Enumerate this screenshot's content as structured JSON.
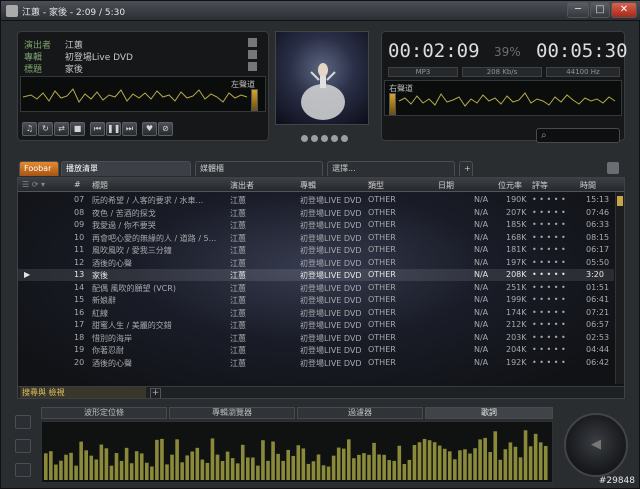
{
  "window": {
    "title": "江蕙 - 家後 - 2:09 / 5:30",
    "buttons": {
      "minimize": "─",
      "maximize": "□",
      "close": "✕"
    }
  },
  "nowplaying": {
    "artist_label": "演出者",
    "artist": "江蕙",
    "album_label": "專輯",
    "album": "初登場Live DVD",
    "title_label": "標題",
    "title": "家後",
    "left_channel": "左聲道",
    "right_channel": "右聲道"
  },
  "timer": {
    "elapsed": "00:02:09",
    "percent": "39%",
    "total": "00:05:30",
    "format": "MP3",
    "bitrate": "208 Kb/s",
    "samplerate": "44100 Hz"
  },
  "controls": [
    "music-icon",
    "repeat-icon",
    "shuffle-icon",
    "stop-icon",
    "prev-icon",
    "pause-icon",
    "next-icon",
    "heart-icon",
    "block-icon"
  ],
  "tabs": {
    "foobar": "Foobar",
    "playlist": "播放清單",
    "media": "媒體櫃",
    "selection": "選擇..."
  },
  "columns": {
    "num": "#",
    "title": "標題",
    "artist": "演出者",
    "album": "專輯",
    "genre": "類型",
    "date": "日期",
    "bitrate": "位元率",
    "rating": "評等",
    "time": "時間"
  },
  "rows": [
    {
      "num": "07",
      "title": "阮的希望 / 人客的要求 / 水車...",
      "artist": "江蕙",
      "album": "初登場LIVE DVD",
      "genre": "OTHER",
      "date": "N/A",
      "bitrate": "190K",
      "rating": "• • • • •",
      "time": "15:13"
    },
    {
      "num": "08",
      "title": "夜色 / 苦酒的探戈",
      "artist": "江蕙",
      "album": "初登場LIVE DVD",
      "genre": "OTHER",
      "date": "N/A",
      "bitrate": "207K",
      "rating": "• • • • •",
      "time": "07:46"
    },
    {
      "num": "09",
      "title": "我愛過 / 你不要哭",
      "artist": "江蕙",
      "album": "初登場LIVE DVD",
      "genre": "OTHER",
      "date": "N/A",
      "bitrate": "185K",
      "rating": "• • • • •",
      "time": "06:33"
    },
    {
      "num": "10",
      "title": "再會吧心愛的無緣的人 / 道路 / 5...",
      "artist": "江蕙",
      "album": "初登場LIVE DVD",
      "genre": "OTHER",
      "date": "N/A",
      "bitrate": "168K",
      "rating": "• • • • •",
      "time": "08:15"
    },
    {
      "num": "11",
      "title": "風吹風吹 / 愛我三分鐘",
      "artist": "江蕙",
      "album": "初登場LIVE DVD",
      "genre": "OTHER",
      "date": "N/A",
      "bitrate": "181K",
      "rating": "• • • • •",
      "time": "06:17"
    },
    {
      "num": "12",
      "title": "酒後的心聲",
      "artist": "江蕙",
      "album": "初登場LIVE DVD",
      "genre": "OTHER",
      "date": "N/A",
      "bitrate": "197K",
      "rating": "• • • • •",
      "time": "05:50"
    },
    {
      "num": "13",
      "title": "家後",
      "artist": "江蕙",
      "album": "初登場LIVE DVD",
      "genre": "OTHER",
      "date": "N/A",
      "bitrate": "208K",
      "rating": "• • • • •",
      "time": "3:20",
      "current": true
    },
    {
      "num": "14",
      "title": "配偶 風吹的願望 (VCR)",
      "artist": "江蕙",
      "album": "初登場LIVE DVD",
      "genre": "OTHER",
      "date": "N/A",
      "bitrate": "251K",
      "rating": "• • • • •",
      "time": "01:51"
    },
    {
      "num": "15",
      "title": "新娘辭",
      "artist": "江蕙",
      "album": "初登場LIVE DVD",
      "genre": "OTHER",
      "date": "N/A",
      "bitrate": "199K",
      "rating": "• • • • •",
      "time": "06:41"
    },
    {
      "num": "16",
      "title": "紅線",
      "artist": "江蕙",
      "album": "初登場LIVE DVD",
      "genre": "OTHER",
      "date": "N/A",
      "bitrate": "174K",
      "rating": "• • • • •",
      "time": "07:21"
    },
    {
      "num": "17",
      "title": "甜蜜人生 / 美麗的交錯",
      "artist": "江蕙",
      "album": "初登場LIVE DVD",
      "genre": "OTHER",
      "date": "N/A",
      "bitrate": "212K",
      "rating": "• • • • •",
      "time": "06:57"
    },
    {
      "num": "18",
      "title": "惜別的海岸",
      "artist": "江蕙",
      "album": "初登場LIVE DVD",
      "genre": "OTHER",
      "date": "N/A",
      "bitrate": "203K",
      "rating": "• • • • •",
      "time": "02:53"
    },
    {
      "num": "19",
      "title": "你著忍耐",
      "artist": "江蕙",
      "album": "初登場LIVE DVD",
      "genre": "OTHER",
      "date": "N/A",
      "bitrate": "204K",
      "rating": "• • • • •",
      "time": "04:44"
    },
    {
      "num": "20",
      "title": "酒後的心聲",
      "artist": "江蕙",
      "album": "初登場LIVE DVD",
      "genre": "OTHER",
      "date": "N/A",
      "bitrate": "192K",
      "rating": "• • • • •",
      "time": "06:42"
    }
  ],
  "bottom_tab": "搜尋與 檢視",
  "bottom": {
    "tabs": [
      "波形定位條",
      "專輯瀏覽器",
      "過濾器",
      "歌詞"
    ],
    "active_tab": "歌詞"
  },
  "watermark": "#29848"
}
